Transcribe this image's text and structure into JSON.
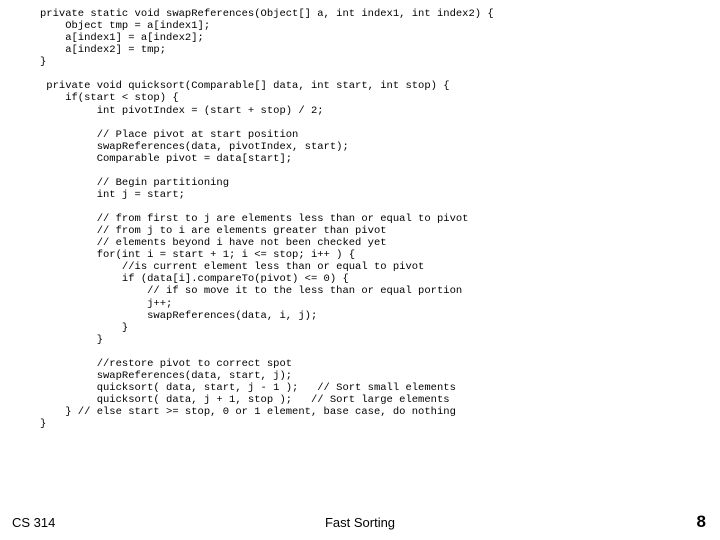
{
  "code": "private static void swapReferences(Object[] a, int index1, int index2) {\n    Object tmp = a[index1];\n    a[index1] = a[index2];\n    a[index2] = tmp;\n}\n\n private void quicksort(Comparable[] data, int start, int stop) {\n    if(start < stop) {\n         int pivotIndex = (start + stop) / 2;\n\n         // Place pivot at start position\n         swapReferences(data, pivotIndex, start);\n         Comparable pivot = data[start];\n\n         // Begin partitioning\n         int j = start;\n\n         // from first to j are elements less than or equal to pivot\n         // from j to i are elements greater than pivot\n         // elements beyond i have not been checked yet\n         for(int i = start + 1; i <= stop; i++ ) {\n             //is current element less than or equal to pivot\n             if (data[i].compareTo(pivot) <= 0) {\n                 // if so move it to the less than or equal portion\n                 j++;\n                 swapReferences(data, i, j);\n             }\n         }\n\n         //restore pivot to correct spot\n         swapReferences(data, start, j);\n         quicksort( data, start, j - 1 );   // Sort small elements\n         quicksort( data, j + 1, stop );   // Sort large elements\n    } // else start >= stop, 0 or 1 element, base case, do nothing\n}",
  "footer": {
    "course": "CS 314",
    "title": "Fast Sorting",
    "page": "8"
  }
}
